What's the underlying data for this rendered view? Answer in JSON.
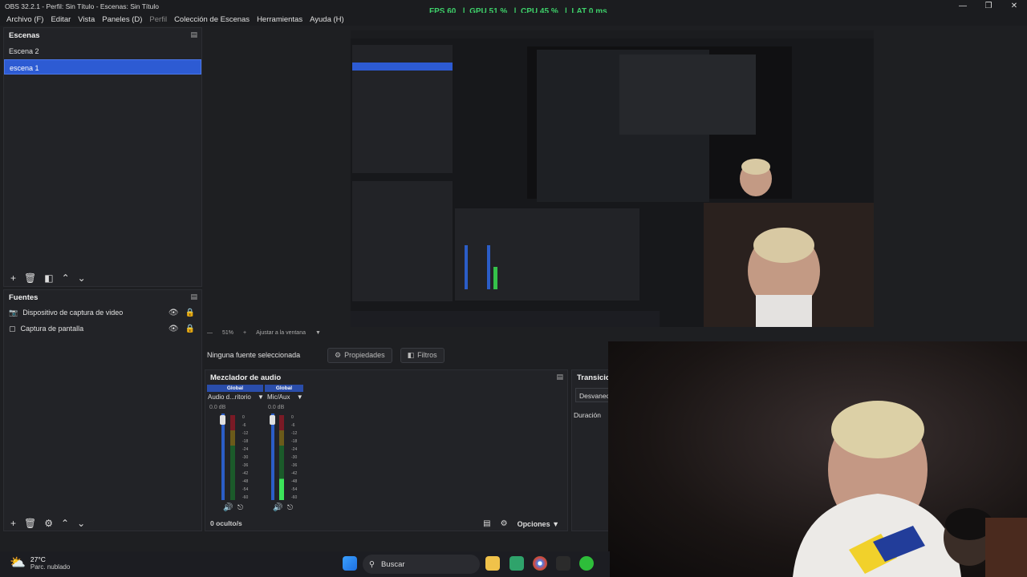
{
  "window": {
    "title": "OBS 32.2.1 - Perfil: Sin Título - Escenas: Sin Título",
    "stats": {
      "fps_label": "FPS",
      "fps": "60",
      "gpu_label": "GPU",
      "gpu": "51 %",
      "cpu_label": "CPU",
      "cpu": "45 %",
      "lat_label": "LAT",
      "lat": "0 ms"
    }
  },
  "menu": [
    "Archivo (F)",
    "Editar",
    "Vista",
    "Paneles (D)",
    "Perfil",
    "Colección de Escenas",
    "Herramientas",
    "Ayuda (H)"
  ],
  "scenes": {
    "title": "Escenas",
    "items": [
      {
        "label": "Escena 2"
      },
      {
        "label": "escena 1",
        "selected": true
      }
    ]
  },
  "sources": {
    "title": "Fuentes",
    "items": [
      {
        "label": "Dispositivo de captura de video"
      },
      {
        "label": "Captura de pantalla"
      }
    ]
  },
  "preview": {
    "zoom": "51%",
    "fit": "Ajustar a la ventana"
  },
  "props_bar": {
    "no_source": "Ninguna fuente seleccionada",
    "properties": "Propiedades",
    "filters": "Filtros"
  },
  "mixer": {
    "title": "Mezclador de audio",
    "channels": [
      {
        "tag": "Global",
        "name": "Audio d...ritorio",
        "db": "0.0 dB",
        "level": 0
      },
      {
        "tag": "Global",
        "name": "Mic/Aux",
        "db": "0.0 dB",
        "level": 0.25
      }
    ],
    "scale": [
      "0",
      "-6",
      "-12",
      "-18",
      "-24",
      "-30",
      "-36",
      "-42",
      "-48",
      "-54",
      "-60"
    ],
    "hidden": "0 oculto/s",
    "options": "Opciones"
  },
  "transitions": {
    "title": "Transiciones",
    "type": "Desvanecer",
    "duration_label": "Duración"
  },
  "taskbar": {
    "temp": "27°C",
    "weather": "Parc. nublado",
    "search": "Buscar"
  }
}
